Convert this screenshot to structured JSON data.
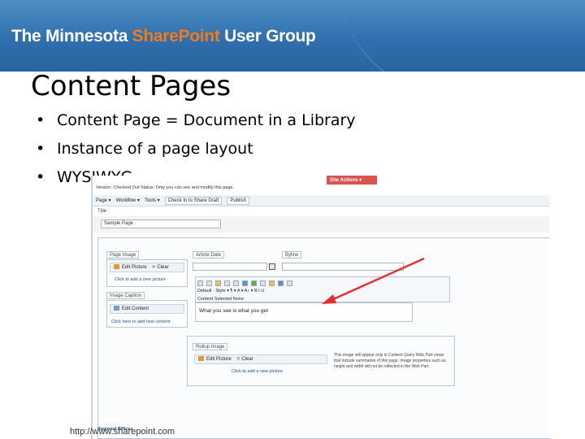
{
  "banner": {
    "title_prefix": "The Minnesota ",
    "title_accent": "Share",
    "title_accent2": "Point",
    "title_suffix": " User Group"
  },
  "slide": {
    "title": "Content Pages",
    "bullets": [
      "Content Page = Document in a Library",
      "Instance of a page layout",
      "WYSIWYG"
    ],
    "footer_url": "http://www.sharepoint.com"
  },
  "screenshot": {
    "site_actions": "Site Actions ▾",
    "status_text": "Version: Checked Out   Status: Only you can see and modify this page.",
    "toolbar": {
      "page": "Page ▾",
      "workflow": "Workflow ▾",
      "tools": "Tools ▾",
      "check_in": "Check In to Share Draft",
      "publish": "Publish"
    },
    "title_label": "Title",
    "title_value": "Sample Page",
    "page_image_label": "Page Image",
    "edit_picture": "Edit Picture",
    "clear": "Clear",
    "add_picture_link": "Click to add a new picture",
    "article_date_label": "Article Date",
    "byline_label": "Byline",
    "image_caption_label": "Image Caption",
    "edit_content": "Edit Content",
    "add_content_link": "Click here to add new content",
    "rte_row2": "Default · Style ▾  ¶ ▾  A ▾  A↕ ▾   B  I  U",
    "rte_row3": "Content  Selected  None",
    "rte_text": "What you see is what you get",
    "rollup_label": "Rollup Image",
    "rollup_note": "This image will appear only in Content Query Web Part views that include summaries of this page. Image properties such as height and width will not be reflected in the Web Part.",
    "regional_offices": "Regional Offices"
  },
  "colors": {
    "accent": "#f07c1c",
    "banner": "#2f6fae",
    "arrow": "#e03030"
  }
}
